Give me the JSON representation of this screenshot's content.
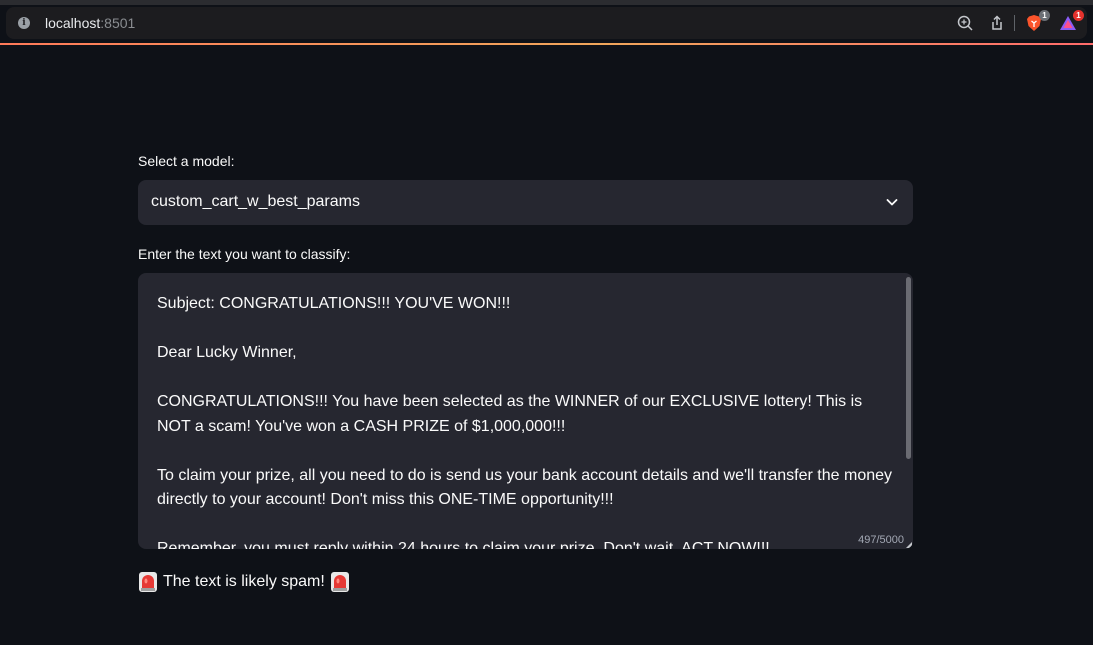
{
  "browser": {
    "host": "localhost",
    "port": ":8501",
    "brave_badge": "1",
    "rewards_badge": "1"
  },
  "model_select": {
    "label": "Select a model:",
    "value": "custom_cart_w_best_params"
  },
  "text_input": {
    "label": "Enter the text you want to classify:",
    "value": "Subject: CONGRATULATIONS!!! YOU'VE WON!!!\n\nDear Lucky Winner,\n\nCONGRATULATIONS!!! You have been selected as the WINNER of our EXCLUSIVE lottery! This is NOT a scam! You've won a CASH PRIZE of $1,000,000!!!\n\nTo claim your prize, all you need to do is send us your bank account details and we'll transfer the money directly to your account! Don't miss this ONE-TIME opportunity!!!\n\nRemember, you must reply within 24 hours to claim your prize. Don't wait, ACT NOW!!!",
    "counter": "497/5000"
  },
  "result": {
    "text": "The text is likely spam!",
    "icon": "siren-icon"
  },
  "colors": {
    "background": "#0e1117",
    "input_bg": "#262730",
    "text": "#fafafa",
    "siren_red": "#e53935"
  }
}
